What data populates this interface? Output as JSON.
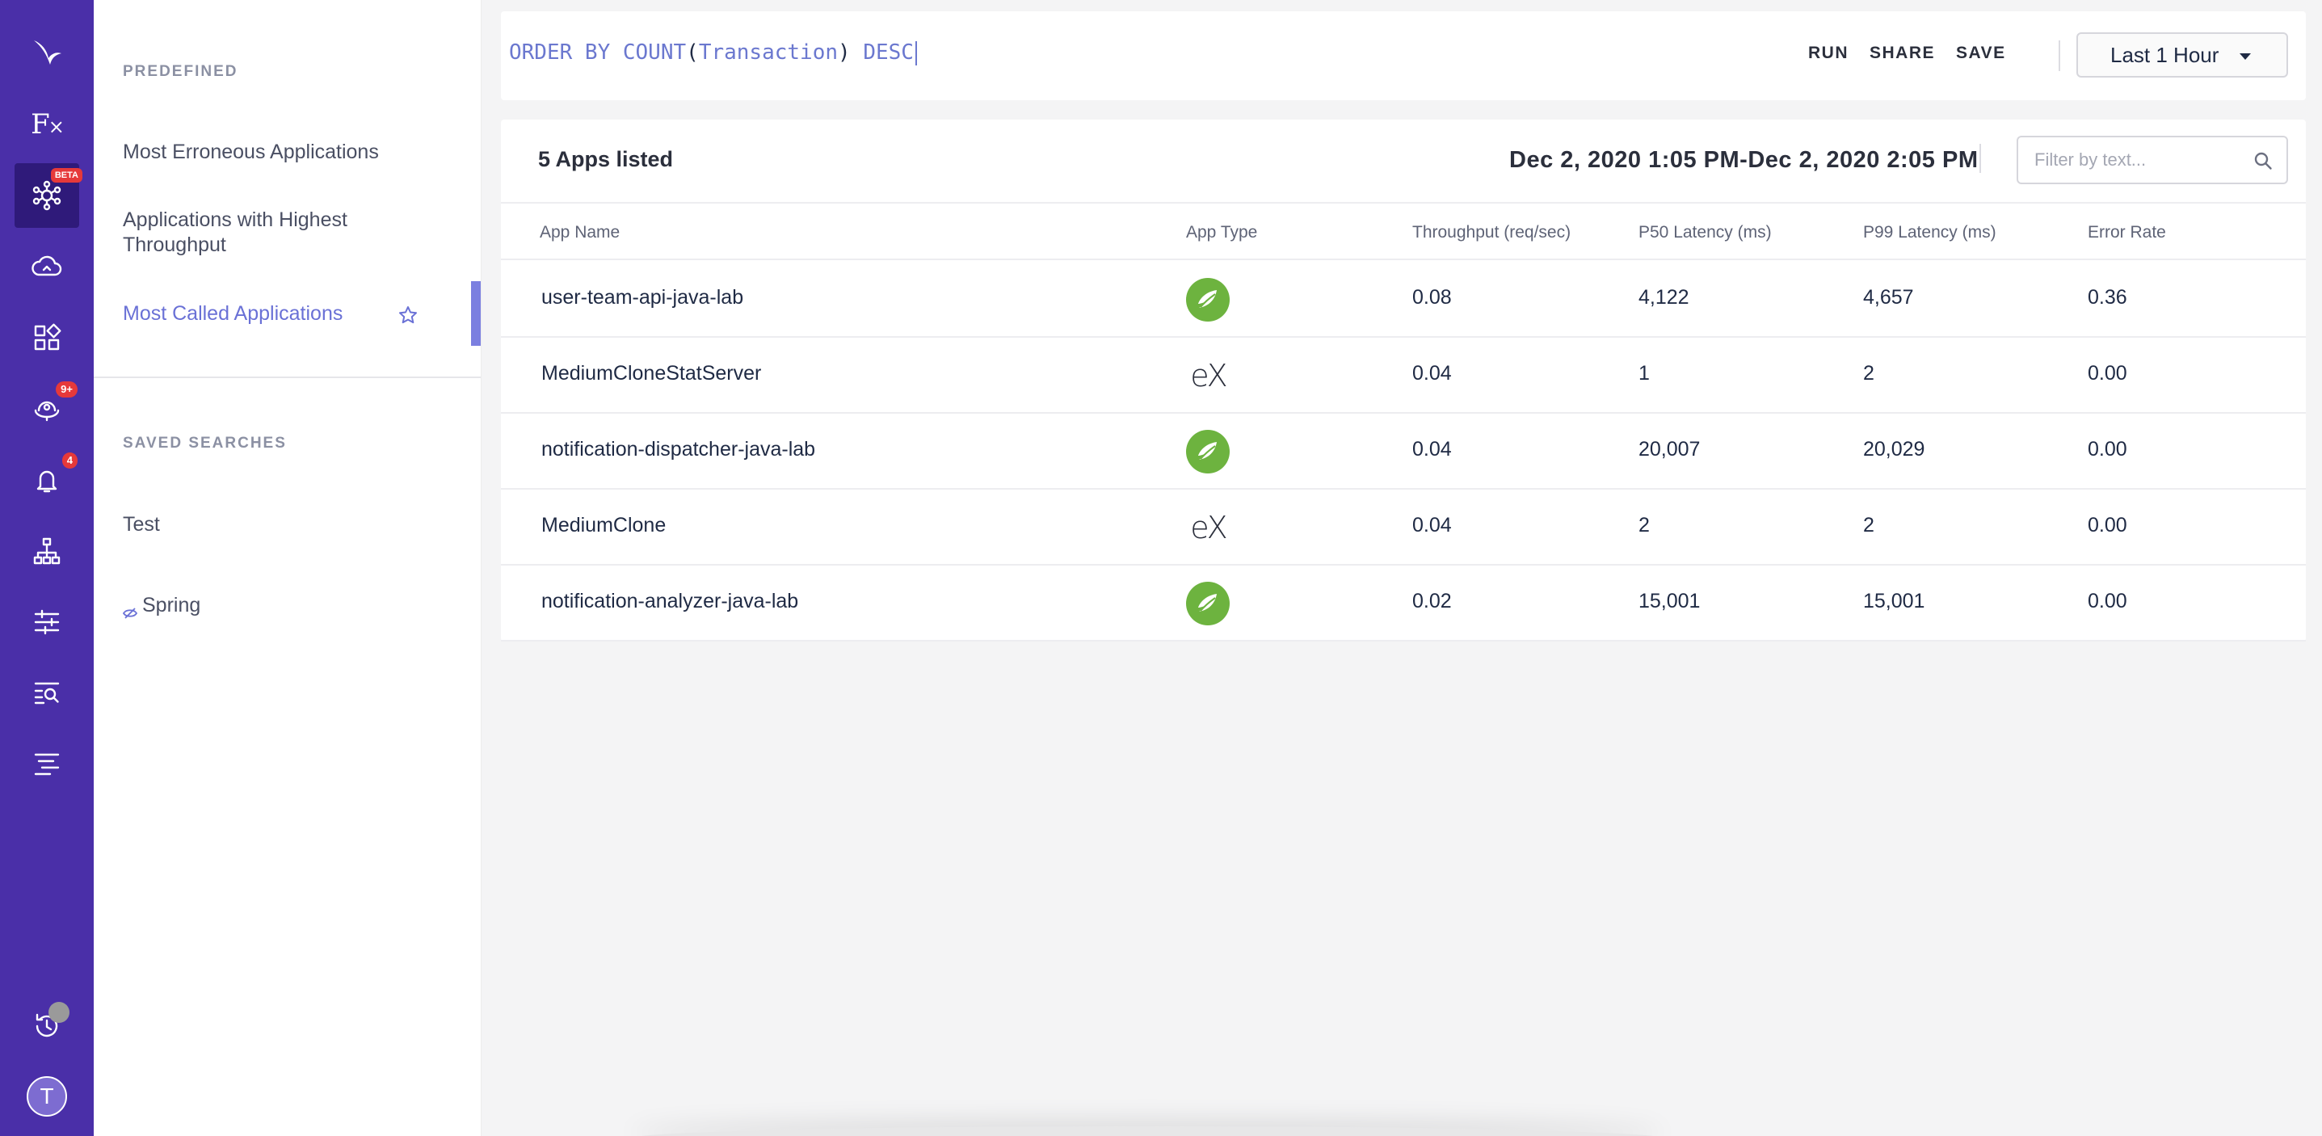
{
  "rail": {
    "beta_badge": "BETA",
    "insights_badge": "9+",
    "alerts_badge": "4",
    "avatar_initial": "T"
  },
  "panel": {
    "predefined_title": "PREDEFINED",
    "predefined": [
      {
        "label": "Most Erroneous Applications"
      },
      {
        "label": "Applications with Highest Throughput"
      },
      {
        "label": "Most Called Applications"
      }
    ],
    "saved_title": "SAVED SEARCHES",
    "saved": [
      {
        "label": "Test"
      },
      {
        "label": "Spring"
      }
    ]
  },
  "query": {
    "kw_order": "ORDER BY COUNT",
    "open_paren": "(",
    "field": "Transaction",
    "close_paren": ")",
    "kw_desc": "DESC"
  },
  "toolbar": {
    "run_label": "RUN",
    "share_label": "SHARE",
    "save_label": "SAVE",
    "time_range": "Last 1 Hour"
  },
  "results": {
    "count_label": "5 Apps listed",
    "date_range": "Dec 2, 2020 1:05 PM-Dec 2, 2020 2:05 PM",
    "filter_placeholder": "Filter by text...",
    "columns": {
      "name": "App Name",
      "type": "App Type",
      "throughput": "Throughput (req/sec)",
      "p50": "P50 Latency (ms)",
      "p99": "P99 Latency (ms)",
      "error": "Error Rate"
    },
    "rows": [
      {
        "name": "user-team-api-java-lab",
        "type": "spring",
        "throughput": "0.08",
        "p50": "4,122",
        "p99": "4,657",
        "error": "0.36"
      },
      {
        "name": "MediumCloneStatServer",
        "type": "express",
        "throughput": "0.04",
        "p50": "1",
        "p99": "2",
        "error": "0.00"
      },
      {
        "name": "notification-dispatcher-java-lab",
        "type": "spring",
        "throughput": "0.04",
        "p50": "20,007",
        "p99": "20,029",
        "error": "0.00"
      },
      {
        "name": "MediumClone",
        "type": "express",
        "throughput": "0.04",
        "p50": "2",
        "p99": "2",
        "error": "0.00"
      },
      {
        "name": "notification-analyzer-java-lab",
        "type": "spring",
        "throughput": "0.02",
        "p50": "15,001",
        "p99": "15,001",
        "error": "0.00"
      }
    ]
  },
  "icons": {
    "express_glyph": "eX"
  }
}
